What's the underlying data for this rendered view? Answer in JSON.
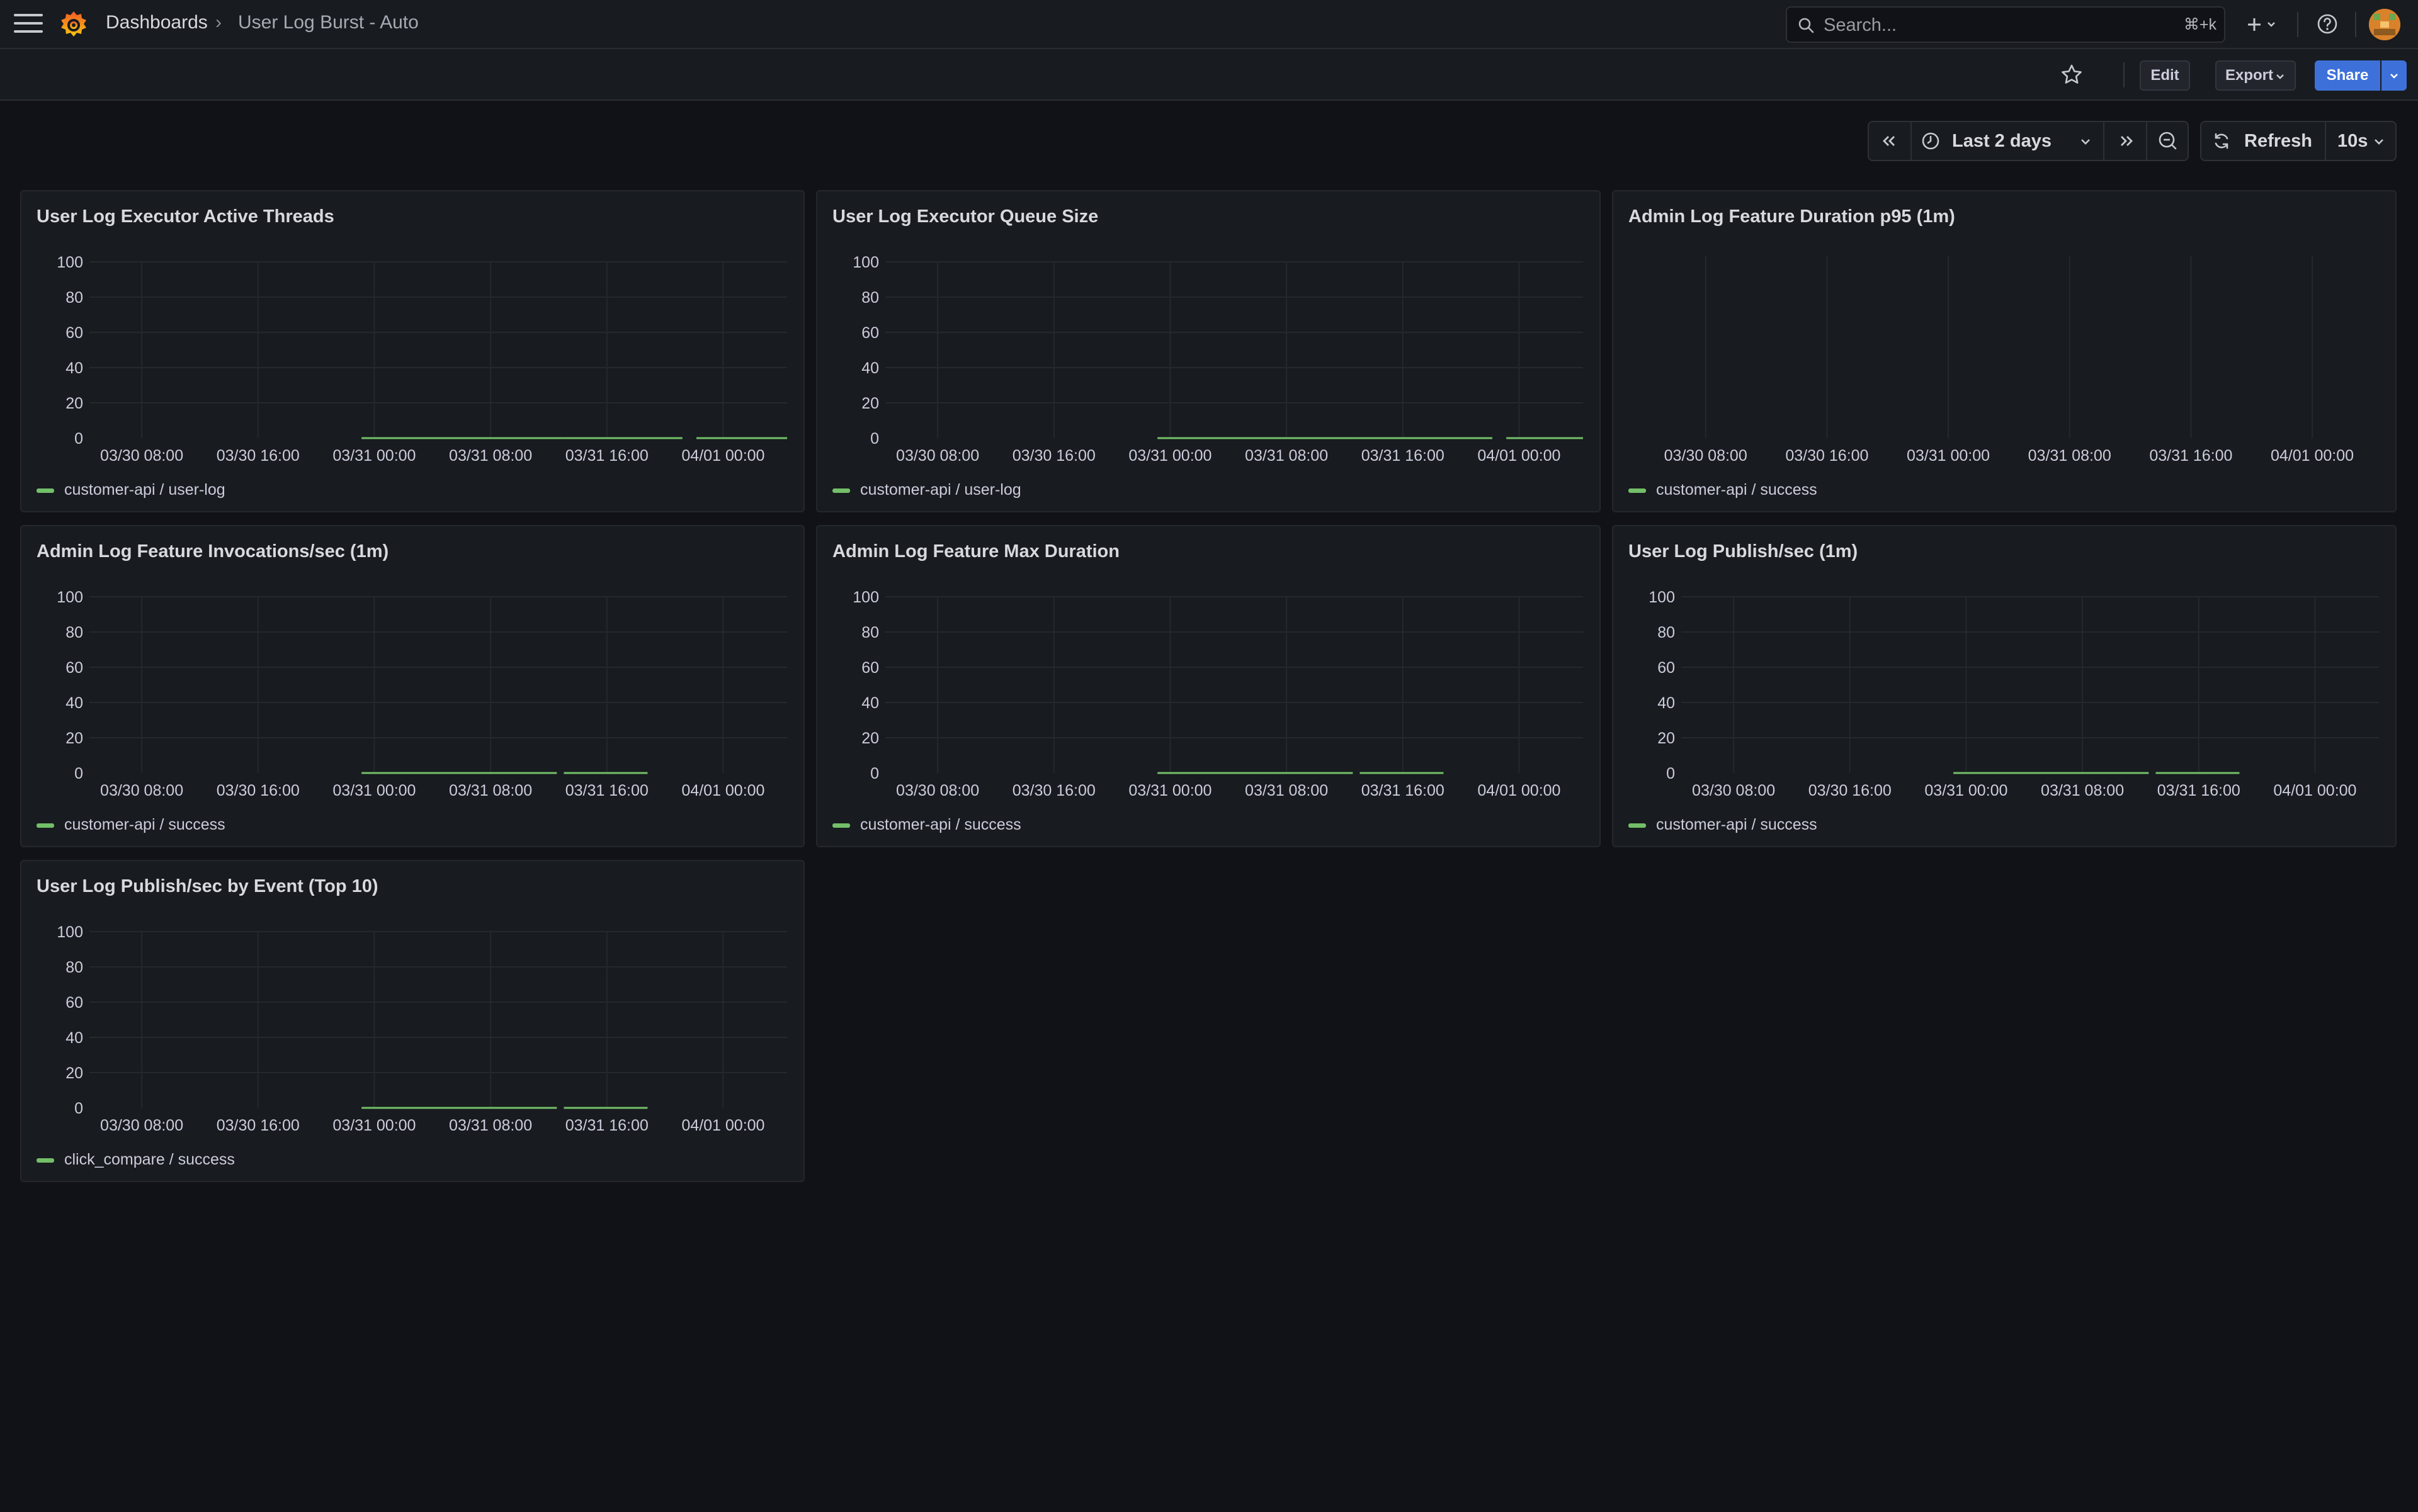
{
  "header": {
    "breadcrumb": {
      "root": "Dashboards",
      "separator": "›",
      "current": "User Log Burst - Auto"
    },
    "search": {
      "placeholder": "Search...",
      "shortcut": "⌘+k"
    },
    "icons": [
      "menu-icon",
      "grafana-logo",
      "search-icon",
      "plus-icon",
      "help-icon",
      "avatar"
    ]
  },
  "toolbar": {
    "edit_label": "Edit",
    "export_label": "Export",
    "share_label": "Share"
  },
  "time_controls": {
    "range_label": "Last 2 days",
    "refresh_label": "Refresh",
    "interval_label": "10s"
  },
  "colors": {
    "series": "#73bf69",
    "accent": "#3d71d9"
  },
  "panels": [
    {
      "title": "User Log Executor Active Threads",
      "legend": "customer-api / user-log",
      "chart_data": {
        "type": "line",
        "x_ticks": [
          "03/30 08:00",
          "03/30 16:00",
          "03/31 00:00",
          "03/31 08:00",
          "03/31 16:00",
          "04/01 00:00"
        ],
        "y_ticks": [
          "100",
          "80",
          "60",
          "40",
          "20",
          "0"
        ],
        "ylim": [
          0,
          100
        ],
        "series": [
          {
            "name": "customer-api / user-log",
            "segments": [
              [
                0.39,
                0.68
              ],
              [
                0.68,
                0.85
              ],
              [
                0.87,
                1.0
              ]
            ],
            "value": 0
          }
        ]
      }
    },
    {
      "title": "User Log Executor Queue Size",
      "legend": "customer-api / user-log",
      "chart_data": {
        "type": "line",
        "x_ticks": [
          "03/30 08:00",
          "03/30 16:00",
          "03/31 00:00",
          "03/31 08:00",
          "03/31 16:00",
          "04/01 00:00"
        ],
        "y_ticks": [
          "100",
          "80",
          "60",
          "40",
          "20",
          "0"
        ],
        "ylim": [
          0,
          100
        ],
        "series": [
          {
            "name": "customer-api / user-log",
            "segments": [
              [
                0.39,
                0.68
              ],
              [
                0.68,
                0.87
              ],
              [
                0.89,
                1.0
              ]
            ],
            "value": 0
          }
        ]
      }
    },
    {
      "title": "Admin Log Feature Duration p95 (1m)",
      "legend": "customer-api / success",
      "chart_data": {
        "type": "line",
        "x_ticks": [
          "03/30 08:00",
          "03/30 16:00",
          "03/31 00:00",
          "03/31 08:00",
          "03/31 16:00",
          "04/01 00:00"
        ],
        "y_ticks": [],
        "series": [
          {
            "name": "customer-api / success",
            "segments": [],
            "value": 0
          }
        ]
      }
    },
    {
      "title": "Admin Log Feature Invocations/sec (1m)",
      "legend": "customer-api / success",
      "chart_data": {
        "type": "line",
        "x_ticks": [
          "03/30 08:00",
          "03/30 16:00",
          "03/31 00:00",
          "03/31 08:00",
          "03/31 16:00",
          "04/01 00:00"
        ],
        "y_ticks": [
          "100",
          "80",
          "60",
          "40",
          "20",
          "0"
        ],
        "ylim": [
          0,
          100
        ],
        "series": [
          {
            "name": "customer-api / success",
            "segments": [
              [
                0.39,
                0.67
              ],
              [
                0.68,
                0.8
              ]
            ],
            "value": 0
          }
        ]
      }
    },
    {
      "title": "Admin Log Feature Max Duration",
      "legend": "customer-api / success",
      "chart_data": {
        "type": "line",
        "x_ticks": [
          "03/30 08:00",
          "03/30 16:00",
          "03/31 00:00",
          "03/31 08:00",
          "03/31 16:00",
          "04/01 00:00"
        ],
        "y_ticks": [
          "100",
          "80",
          "60",
          "40",
          "20",
          "0"
        ],
        "ylim": [
          0,
          100
        ],
        "series": [
          {
            "name": "customer-api / success",
            "segments": [
              [
                0.39,
                0.67
              ],
              [
                0.68,
                0.8
              ]
            ],
            "value": 0
          }
        ]
      }
    },
    {
      "title": "User Log Publish/sec (1m)",
      "legend": "customer-api / success",
      "chart_data": {
        "type": "line",
        "x_ticks": [
          "03/30 08:00",
          "03/30 16:00",
          "03/31 00:00",
          "03/31 08:00",
          "03/31 16:00",
          "04/01 00:00"
        ],
        "y_ticks": [
          "100",
          "80",
          "60",
          "40",
          "20",
          "0"
        ],
        "ylim": [
          0,
          100
        ],
        "series": [
          {
            "name": "customer-api / success",
            "segments": [
              [
                0.39,
                0.67
              ],
              [
                0.68,
                0.8
              ]
            ],
            "value": 0
          }
        ]
      }
    },
    {
      "title": "User Log Publish/sec by Event (Top 10)",
      "legend": "click_compare / success",
      "chart_data": {
        "type": "line",
        "x_ticks": [
          "03/30 08:00",
          "03/30 16:00",
          "03/31 00:00",
          "03/31 08:00",
          "03/31 16:00",
          "04/01 00:00"
        ],
        "y_ticks": [
          "100",
          "80",
          "60",
          "40",
          "20",
          "0"
        ],
        "ylim": [
          0,
          100
        ],
        "series": [
          {
            "name": "click_compare / success",
            "segments": [
              [
                0.39,
                0.67
              ],
              [
                0.68,
                0.8
              ]
            ],
            "value": 0
          }
        ]
      }
    }
  ]
}
